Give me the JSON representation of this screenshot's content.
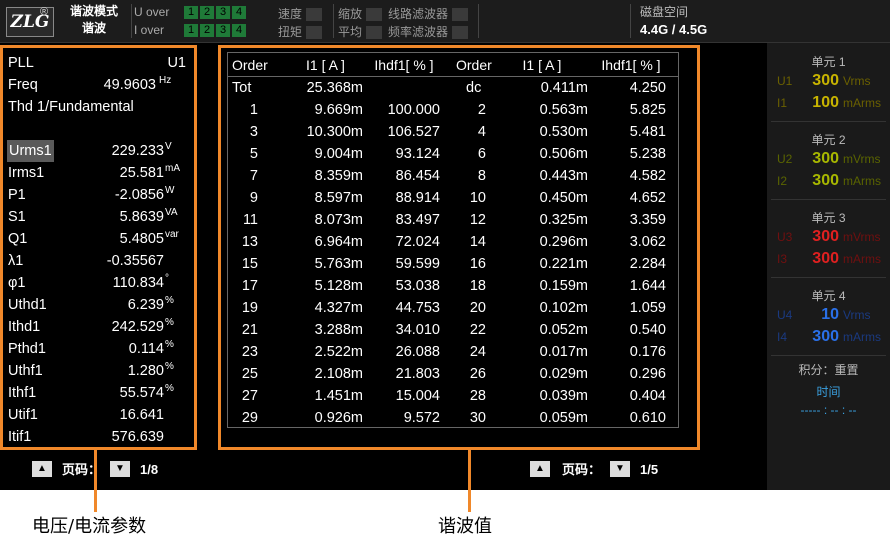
{
  "topbar": {
    "logo": "ZLG",
    "logo_mark": "®",
    "mode_title": "谐波模式",
    "mode_sub": "谐波",
    "u_over": "U over",
    "i_over": "I over",
    "channels": [
      "1",
      "2",
      "3",
      "4"
    ],
    "speed": "速度",
    "torque": "扭矩",
    "zoom": "缩放",
    "average": "平均",
    "line_filter": "线路滤波器",
    "freq_filter": "频率滤波器",
    "disk_label": "磁盘空间",
    "disk_value": "4.4G / 4.5G"
  },
  "params": [
    {
      "name": "PLL",
      "value": "U1",
      "unit": ""
    },
    {
      "name": "Freq",
      "value": "49.9603",
      "unit": "Hz"
    },
    {
      "name": "Thd  1/Fundamental",
      "value": "",
      "unit": ""
    },
    {
      "name": "",
      "value": "",
      "unit": ""
    },
    {
      "name": "Urms1",
      "value": "229.233",
      "unit": "V"
    },
    {
      "name": "Irms1",
      "value": "25.581",
      "unit": "mA"
    },
    {
      "name": "P1",
      "value": "-2.0856",
      "unit": "W"
    },
    {
      "name": "S1",
      "value": "5.8639",
      "unit": "VA"
    },
    {
      "name": "Q1",
      "value": "5.4805",
      "unit": "var"
    },
    {
      "name": "λ1",
      "value": "-0.35567",
      "unit": ""
    },
    {
      "name": "φ1",
      "value": "110.834",
      "unit": "°"
    },
    {
      "name": "Uthd1",
      "value": "6.239",
      "unit": "%"
    },
    {
      "name": "Ithd1",
      "value": "242.529",
      "unit": "%"
    },
    {
      "name": "Pthd1",
      "value": "0.114",
      "unit": "%"
    },
    {
      "name": "Uthf1",
      "value": "1.280",
      "unit": "%"
    },
    {
      "name": "Ithf1",
      "value": "55.574",
      "unit": "%"
    },
    {
      "name": "Utif1",
      "value": "16.641",
      "unit": ""
    },
    {
      "name": "Itif1",
      "value": "576.639",
      "unit": ""
    }
  ],
  "harmonics": {
    "headers": [
      "Order",
      "I1 [ A ]",
      "Ihdf1[ % ]",
      "Order",
      "I1 [ A ]",
      "Ihdf1[ % ]"
    ],
    "rows": [
      [
        "Tot",
        "25.368m",
        "",
        "dc",
        "0.411m",
        "4.250"
      ],
      [
        "1",
        "9.669m",
        "100.000",
        "2",
        "0.563m",
        "5.825"
      ],
      [
        "3",
        "10.300m",
        "106.527",
        "4",
        "0.530m",
        "5.481"
      ],
      [
        "5",
        "9.004m",
        "93.124",
        "6",
        "0.506m",
        "5.238"
      ],
      [
        "7",
        "8.359m",
        "86.454",
        "8",
        "0.443m",
        "4.582"
      ],
      [
        "9",
        "8.597m",
        "88.914",
        "10",
        "0.450m",
        "4.652"
      ],
      [
        "11",
        "8.073m",
        "83.497",
        "12",
        "0.325m",
        "3.359"
      ],
      [
        "13",
        "6.964m",
        "72.024",
        "14",
        "0.296m",
        "3.062"
      ],
      [
        "15",
        "5.763m",
        "59.599",
        "16",
        "0.221m",
        "2.284"
      ],
      [
        "17",
        "5.128m",
        "53.038",
        "18",
        "0.159m",
        "1.644"
      ],
      [
        "19",
        "4.327m",
        "44.753",
        "20",
        "0.102m",
        "1.059"
      ],
      [
        "21",
        "3.288m",
        "34.010",
        "22",
        "0.052m",
        "0.540"
      ],
      [
        "23",
        "2.522m",
        "26.088",
        "24",
        "0.017m",
        "0.176"
      ],
      [
        "25",
        "2.108m",
        "21.803",
        "26",
        "0.029m",
        "0.296"
      ],
      [
        "27",
        "1.451m",
        "15.004",
        "28",
        "0.039m",
        "0.404"
      ],
      [
        "29",
        "0.926m",
        "9.572",
        "30",
        "0.059m",
        "0.610"
      ]
    ]
  },
  "units": [
    {
      "title": "单元 1",
      "u": {
        "n": "U1",
        "v": "300",
        "unit": "Vrms"
      },
      "i": {
        "n": "I1",
        "v": "100",
        "unit": "mArms"
      },
      "color": "#c8b400",
      "dim": "#6a6000"
    },
    {
      "title": "单元 2",
      "u": {
        "n": "U2",
        "v": "300",
        "unit": "mVrms"
      },
      "i": {
        "n": "I2",
        "v": "300",
        "unit": "mArms"
      },
      "color": "#a8b800",
      "dim": "#5a6400"
    },
    {
      "title": "单元 3",
      "u": {
        "n": "U3",
        "v": "300",
        "unit": "mVrms"
      },
      "i": {
        "n": "I3",
        "v": "300",
        "unit": "mArms"
      },
      "color": "#e02020",
      "dim": "#701010"
    },
    {
      "title": "单元 4",
      "u": {
        "n": "U4",
        "v": "10",
        "unit": "Vrms"
      },
      "i": {
        "n": "I4",
        "v": "300",
        "unit": "mArms"
      },
      "color": "#2a70e8",
      "dim": "#1a3a80"
    }
  ],
  "integration": {
    "label": "积分：重置",
    "time_label": "时间",
    "time_value": "----- : -- : --"
  },
  "pager_left": {
    "label": "页码：",
    "page": "1/8"
  },
  "pager_right": {
    "label": "页码：",
    "page": "1/5"
  },
  "annotations": {
    "left": "电压/电流参数",
    "right": "谐波值"
  },
  "colors": {
    "accent_orange": "#f0882a",
    "range_green": "#1f7a38",
    "integration_blue": "#3aa0e0"
  }
}
